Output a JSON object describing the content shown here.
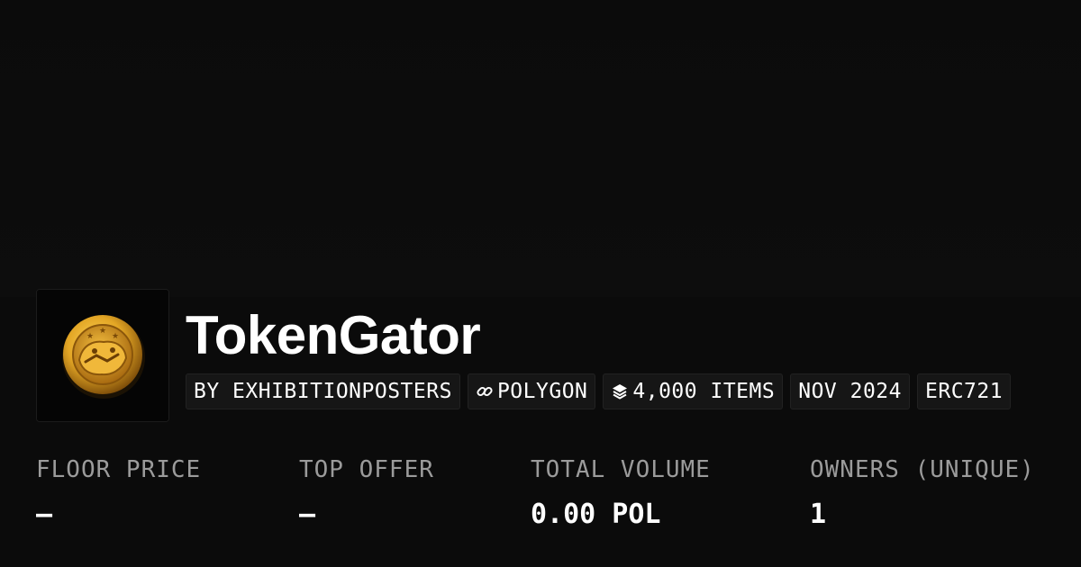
{
  "collection": {
    "name": "TokenGator",
    "creator": "BY EXHIBITIONPOSTERS",
    "chain": "POLYGON",
    "items": "4,000 ITEMS",
    "date": "NOV 2024",
    "standard": "ERC721"
  },
  "stats": [
    {
      "label": "FLOOR PRICE",
      "value": "–"
    },
    {
      "label": "TOP OFFER",
      "value": "–"
    },
    {
      "label": "TOTAL VOLUME",
      "value": "0.00 POL"
    },
    {
      "label": "OWNERS (UNIQUE)",
      "value": "1"
    }
  ],
  "icons": {
    "avatar": "gold-gator-coin",
    "chain": "link-icon",
    "items": "layers-icon"
  },
  "colors": {
    "background": "#0b0b0b",
    "chip_background": "#161616",
    "label_gray": "#9b9b9b",
    "coin_gold": "#e3a625"
  }
}
